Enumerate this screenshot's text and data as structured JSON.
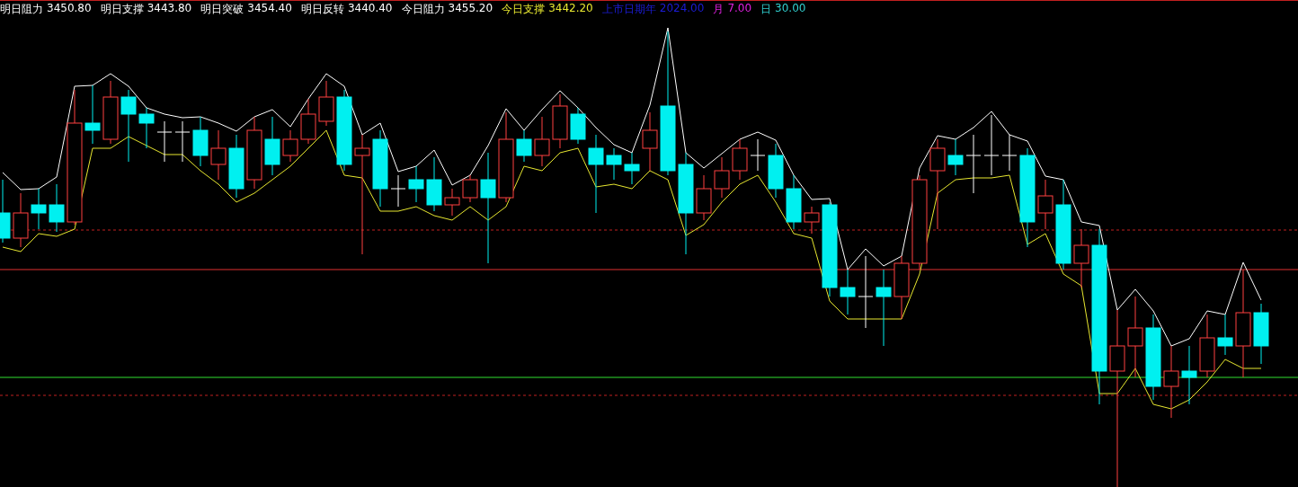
{
  "legend": [
    {
      "label": "明日阻力",
      "value": "3450.80",
      "color": "#ffffff"
    },
    {
      "label": "明日支撑",
      "value": "3443.80",
      "color": "#ffffff"
    },
    {
      "label": "明日突破",
      "value": "3454.40",
      "color": "#ffffff"
    },
    {
      "label": "明日反转",
      "value": "3440.40",
      "color": "#ffffff"
    },
    {
      "label": "今日阻力",
      "value": "3455.20",
      "color": "#ffffff"
    },
    {
      "label": "今日支撑",
      "value": "3442.20",
      "color": "#e8e830"
    },
    {
      "label": "上市日期年",
      "value": "2024.00",
      "color": "#1c1cd8"
    },
    {
      "label": "月",
      "value": "7.00",
      "color": "#e020e0"
    },
    {
      "label": "日",
      "value": "30.00",
      "color": "#30d0d0"
    }
  ]
}
